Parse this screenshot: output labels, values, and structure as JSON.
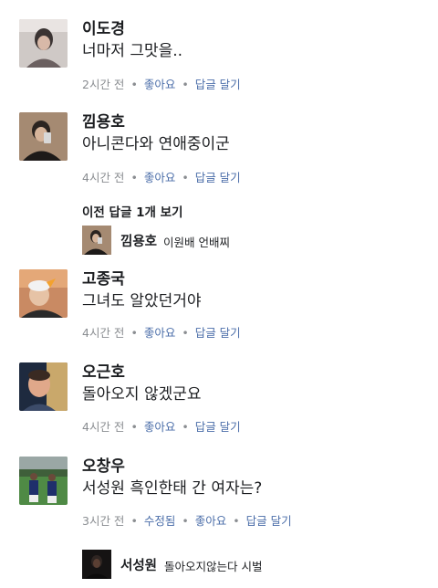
{
  "comments": [
    {
      "name": "이도경",
      "text": "너마저 그맛을..",
      "time": "2시간 전",
      "like": "좋아요",
      "reply": "답글 달기",
      "avatar_icon": "person-portrait"
    },
    {
      "name": "낌용호",
      "text": "아니콘다와 연애중이군",
      "time": "4시간 전",
      "like": "좋아요",
      "reply": "답글 달기",
      "avatar_icon": "mirror-selfie"
    },
    {
      "name": "고종국",
      "text": "그녀도 알았던거야",
      "time": "4시간 전",
      "like": "좋아요",
      "reply": "답글 달기",
      "avatar_icon": "person-with-bird"
    },
    {
      "name": "오근호",
      "text": "돌아오지 않겠군요",
      "time": "4시간 전",
      "like": "좋아요",
      "reply": "답글 달기",
      "avatar_icon": "painted-portrait"
    },
    {
      "name": "오창우",
      "text": "서성원 흑인한태 간 여자는?",
      "time": "3시간 전",
      "edited": "수정됨",
      "like": "좋아요",
      "reply": "답글 달기",
      "avatar_icon": "football-players"
    }
  ],
  "previous_replies": "이전 답글 1개 보기",
  "replies": [
    {
      "name": "낌용호",
      "text": "이원배 언배찌",
      "avatar_icon": "mirror-selfie"
    },
    {
      "name": "서성원",
      "text": "돌아오지않는다 시벌",
      "avatar_icon": "dark-portrait"
    }
  ],
  "colors": {
    "link": "#4b6ea9",
    "meta": "#8a8d91",
    "text": "#1c1e21"
  }
}
